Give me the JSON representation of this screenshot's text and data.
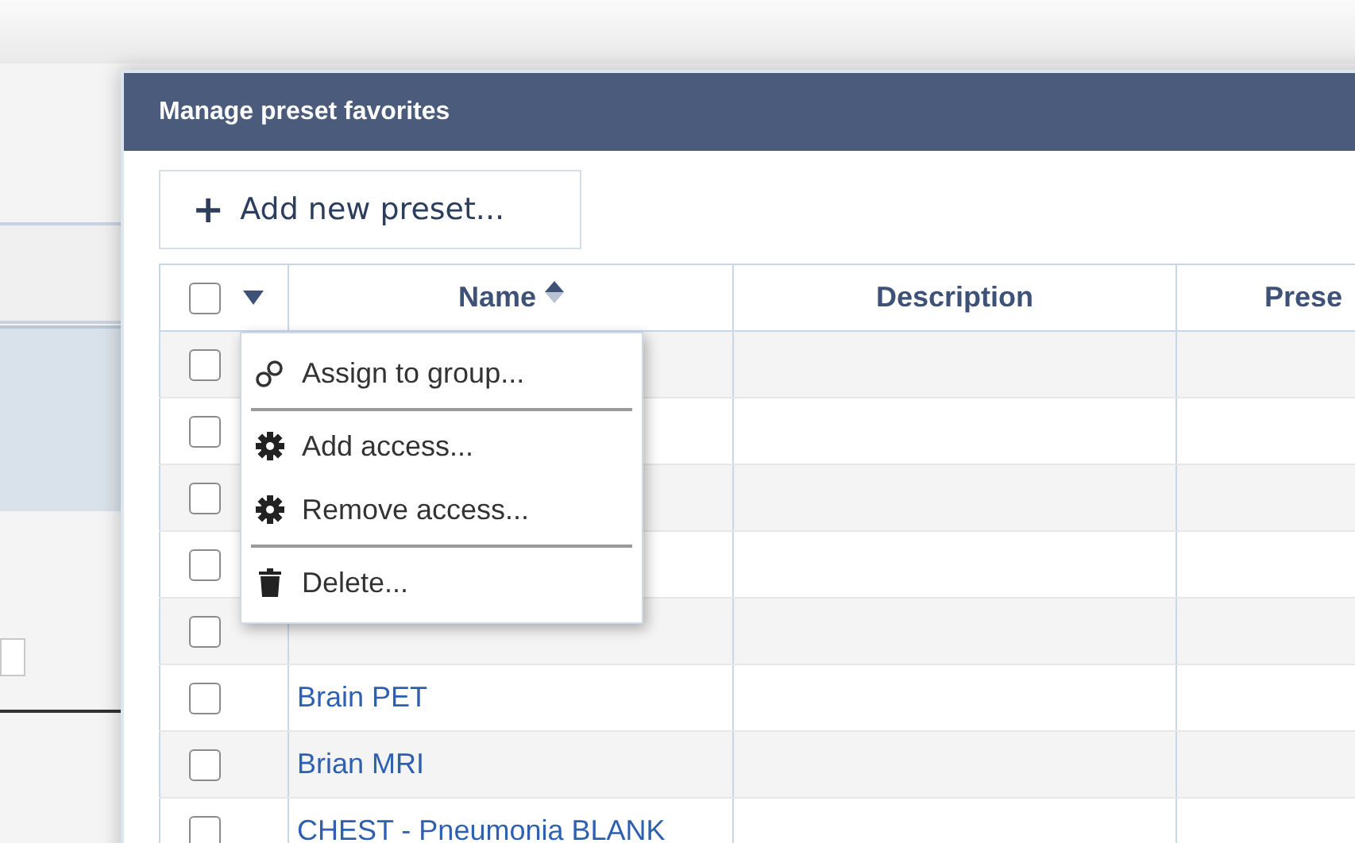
{
  "dialog": {
    "title": "Manage preset favorites"
  },
  "add_button": {
    "icon": "+",
    "label": "Add new preset..."
  },
  "table": {
    "select_all": {
      "checked": false
    },
    "columns": [
      "Name",
      "Description",
      "Prese"
    ],
    "rows": [
      {
        "checked": false
      },
      {
        "checked": false
      },
      {
        "checked": false
      },
      {
        "checked": false
      },
      {
        "checked": false
      },
      {
        "checked": false,
        "name": "Brain PET"
      },
      {
        "checked": false,
        "name": "Brian MRI"
      },
      {
        "checked": false,
        "name": "CHEST - Pneumonia BLANK"
      }
    ]
  },
  "context_menu": {
    "items": [
      {
        "kind": "link",
        "label": "Assign to group..."
      },
      {
        "kind": "separator"
      },
      {
        "kind": "gear",
        "label": "Add access..."
      },
      {
        "kind": "gear",
        "label": "Remove access..."
      },
      {
        "kind": "separator"
      },
      {
        "kind": "trash",
        "label": "Delete..."
      }
    ]
  }
}
